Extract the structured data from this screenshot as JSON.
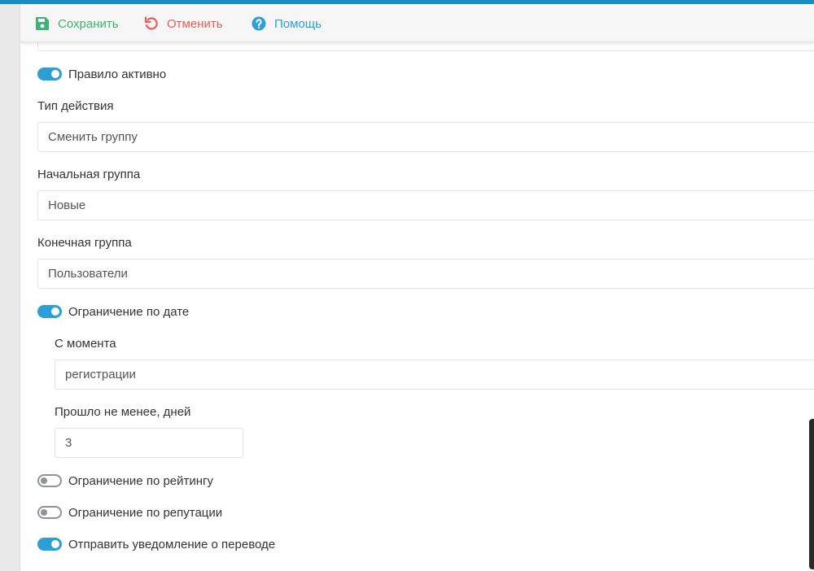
{
  "toolbar": {
    "save_label": "Сохранить",
    "cancel_label": "Отменить",
    "help_label": "Помощь"
  },
  "form": {
    "rule_active": {
      "label": "Правило активно",
      "on": true
    },
    "action_type": {
      "label": "Тип действия",
      "value": "Сменить группу"
    },
    "start_group": {
      "label": "Начальная группа",
      "value": "Новые"
    },
    "end_group": {
      "label": "Конечная группа",
      "value": "Пользователи"
    },
    "date_limit": {
      "label": "Ограничение по дате",
      "on": true
    },
    "since": {
      "label": "С момента",
      "value": "регистрации"
    },
    "days_passed": {
      "label": "Прошло не менее, дней",
      "value": "3"
    },
    "rating_limit": {
      "label": "Ограничение по рейтингу",
      "on": false
    },
    "reputation_limit": {
      "label": "Ограничение по репутации",
      "on": false
    },
    "notify": {
      "label": "Отправить уведомление о переводе",
      "on": true
    }
  },
  "colors": {
    "accent": "#2c9fd6",
    "save": "#3cb371",
    "cancel": "#e85c5c",
    "top_stripe": "#1a8bc4"
  },
  "icons": {
    "save": "floppy-disk-icon",
    "cancel": "undo-icon",
    "help": "question-circle-icon"
  }
}
